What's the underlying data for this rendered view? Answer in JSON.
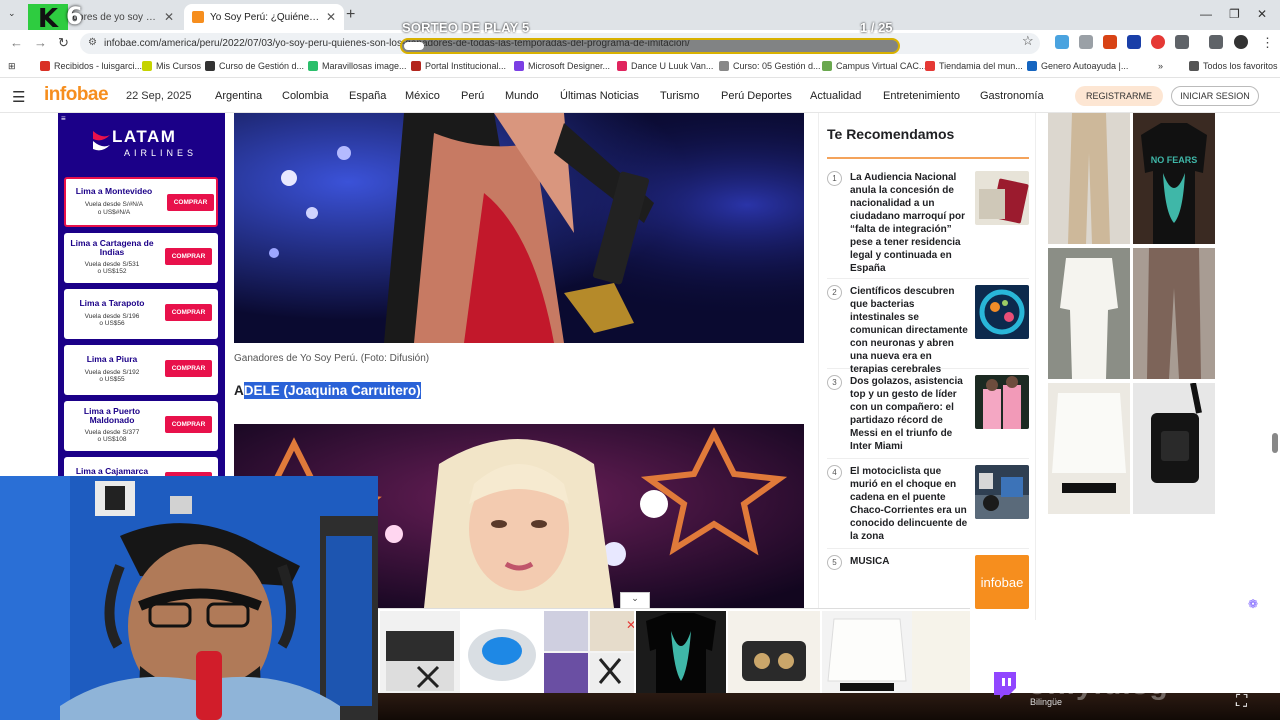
{
  "browser": {
    "tabs": [
      {
        "title": "Ganadores de yo soy peru - Bu",
        "favicon_color": "#1a73e8"
      },
      {
        "title": "Yo Soy Perú: ¿Quiénes son los g",
        "favicon_color": "#f68e1e"
      }
    ],
    "url": "infobae.com/america/peru/2022/07/03/yo-soy-peru-quienes-son-los-ganadores-de-todas-las-temporadas-del-programa-de-imitacion/",
    "bookmarks": [
      {
        "label": "Recibidos - luisgarci...",
        "color": "#d93025"
      },
      {
        "label": "Mis Cursos",
        "color": "#c5d300"
      },
      {
        "label": "Curso de Gestión d...",
        "color": "#333333"
      },
      {
        "label": "Maravillosas image...",
        "color": "#2bbf6b"
      },
      {
        "label": "Portal Institucional...",
        "color": "#b3261e"
      },
      {
        "label": "Microsoft Designer...",
        "color": "#7b3fe4"
      },
      {
        "label": "Dance U Luuk Van...",
        "color": "#e0245e"
      },
      {
        "label": "Curso: 05 Gestión d...",
        "color": "#888888"
      },
      {
        "label": "Campus Virtual CAC...",
        "color": "#6aa84f"
      },
      {
        "label": "Tiendamia del mun...",
        "color": "#e53935"
      },
      {
        "label": "Genero Autoayuda |...",
        "color": "#1565c0"
      },
      {
        "label": "Todos los favoritos",
        "color": "#555555"
      }
    ]
  },
  "stream": {
    "title": "SORTEO DE PLAY 5",
    "counter": "1  / 25",
    "progress": 0.04,
    "handle": "onlyluisg",
    "brand_letter": "K",
    "brand_number": "6",
    "language": "Bilingüe"
  },
  "site": {
    "logo": "infobae",
    "date": "22 Sep, 2025",
    "nav": [
      "Argentina",
      "Colombia",
      "España",
      "México",
      "Perú",
      "Mundo",
      "Últimas Noticias",
      "Turismo",
      "Perú Deportes",
      "Actualidad",
      "Entretenimiento",
      "Gastronomía"
    ],
    "register": "REGISTRARME",
    "login": "INICIAR SESION"
  },
  "ad_latam": {
    "brand": "LATAM",
    "sub": "AIRLINES",
    "flights": [
      {
        "dest": "Lima a Montevideo",
        "price1": "Vuela desde S/#N/A",
        "price2": "o US$#N/A",
        "cta": "COMPRAR"
      },
      {
        "dest": "Lima a Cartagena de Indias",
        "price1": "Vuela desde S/531",
        "price2": "o US$152",
        "cta": "COMPRAR"
      },
      {
        "dest": "Lima a Tarapoto",
        "price1": "Vuela desde S/196",
        "price2": "o US$56",
        "cta": "COMPRAR"
      },
      {
        "dest": "Lima a Piura",
        "price1": "Vuela desde S/192",
        "price2": "o US$55",
        "cta": "COMPRAR"
      },
      {
        "dest": "Lima a Puerto Maldonado",
        "price1": "Vuela desde S/377",
        "price2": "o US$108",
        "cta": "COMPRAR"
      },
      {
        "dest": "Lima a Cajamarca",
        "price1": "",
        "price2": "",
        "cta": "COMPRAR"
      }
    ]
  },
  "article": {
    "caption": "Ganadores de Yo Soy Perú. (Foto: Difusión)",
    "subhead_first": "A",
    "subhead_rest": "DELE (Joaquina Carruitero)"
  },
  "recs": {
    "title": "Te Recomendamos",
    "items": [
      {
        "num": "1",
        "text": "La Audiencia Nacional anula la concesión de nacionalidad a un ciudadano marroquí por “falta de integración” pese a tener residencia legal y continuada en España"
      },
      {
        "num": "2",
        "text": "Científicos descubren que bacterias intestinales se comunican directamente con neuronas y abren una nueva era en terapias cerebrales"
      },
      {
        "num": "3",
        "text": "Dos golazos, asistencia top y un gesto de líder con un compañero: el partidazo récord de Messi en el triunfo de Inter Miami"
      },
      {
        "num": "4",
        "text": "El motociclista que murió en el choque en cadena en el puente Chaco-Corrientes era un conocido delincuente de la zona"
      },
      {
        "num": "5",
        "text": "MUSICA",
        "thumb_label": "infobae"
      }
    ]
  },
  "fashion_ad": {
    "shirt_text": "NO FEARS"
  },
  "colors": {
    "infobae_orange": "#f68e1e",
    "latam_blue": "#1b0088",
    "latam_red": "#e8114b",
    "selection_blue": "#2a62d7",
    "progress_gold": "#d8b100"
  }
}
